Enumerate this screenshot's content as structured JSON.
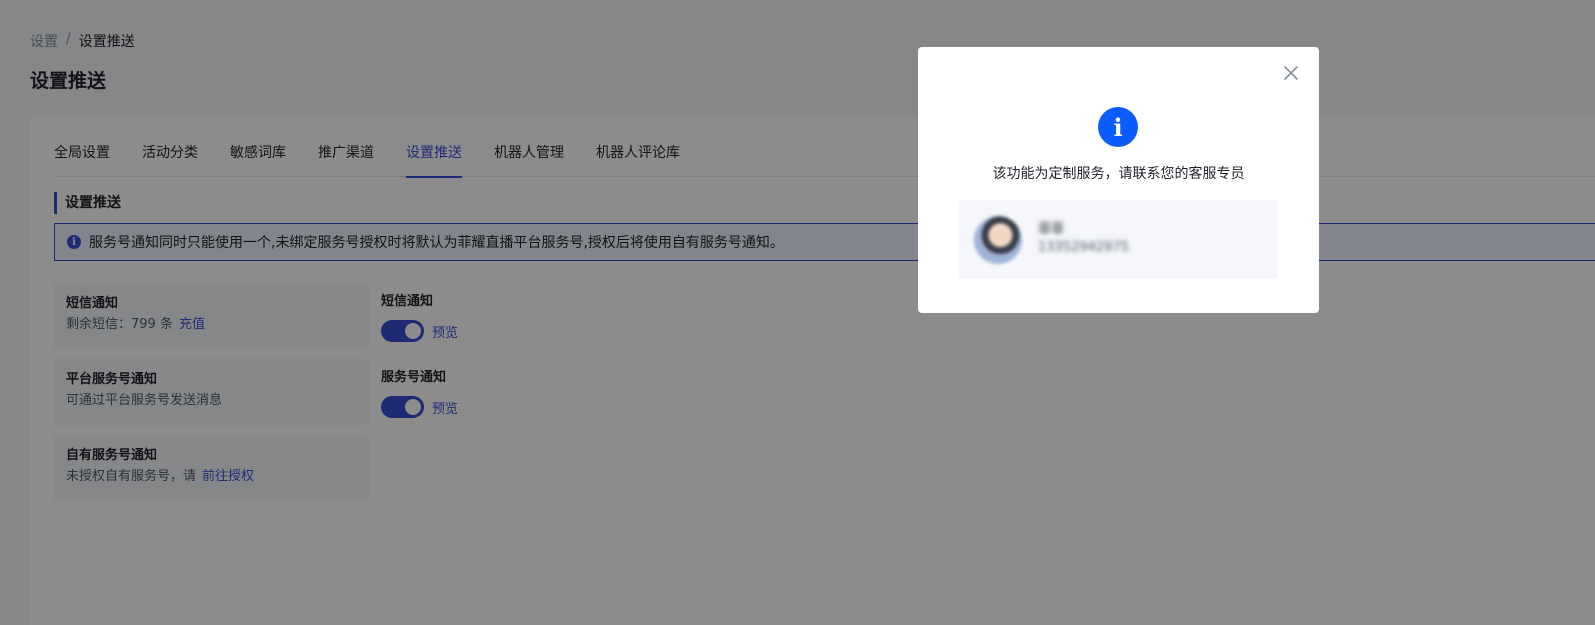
{
  "breadcrumb": {
    "root": "设置",
    "sep": "/",
    "current": "设置推送"
  },
  "page_title": "设置推送",
  "tabs": [
    {
      "label": "全局设置"
    },
    {
      "label": "活动分类"
    },
    {
      "label": "敏感词库"
    },
    {
      "label": "推广渠道"
    },
    {
      "label": "设置推送",
      "active": true
    },
    {
      "label": "机器人管理"
    },
    {
      "label": "机器人评论库"
    }
  ],
  "section_title": "设置推送",
  "notice": {
    "icon": "info-icon",
    "text": "服务号通知同时只能使用一个,未绑定服务号授权时将默认为菲耀直播平台服务号,授权后将使用自有服务号通知。"
  },
  "cards": [
    {
      "title": "短信通知",
      "desc": "剩余短信：799 条",
      "link": "充值"
    },
    {
      "title": "平台服务号通知",
      "desc": "可通过平台服务号发送消息"
    },
    {
      "title": "自有服务号通知",
      "desc": "未授权自有服务号，请",
      "link": "前往授权"
    }
  ],
  "options": [
    {
      "title": "短信通知",
      "enabled": true,
      "preview": "预览"
    },
    {
      "title": "服务号通知",
      "enabled": true,
      "preview": "预览"
    }
  ],
  "modal": {
    "message": "该功能为定制服务，请联系您的客服专员",
    "contact": {
      "name": "菲菲",
      "phone": "13352942975"
    }
  },
  "colors": {
    "accent": "#3a4ed5",
    "info": "#0b5cff"
  }
}
